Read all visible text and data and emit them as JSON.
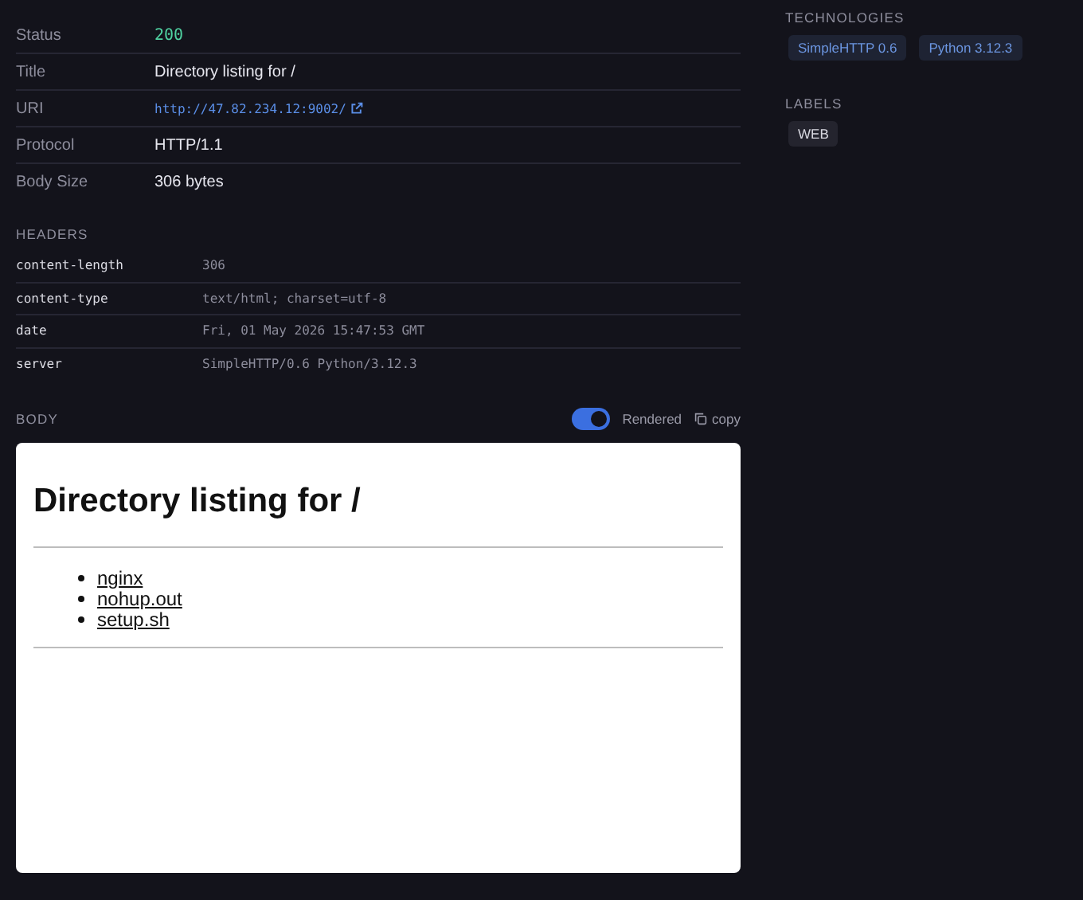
{
  "http": {
    "rows": [
      {
        "label": "Status",
        "value": "200",
        "kind": "status"
      },
      {
        "label": "Title",
        "value": "Directory listing for /",
        "kind": "text"
      },
      {
        "label": "URI",
        "value": "http://47.82.234.12:9002/",
        "kind": "link"
      },
      {
        "label": "Protocol",
        "value": "HTTP/1.1",
        "kind": "text"
      },
      {
        "label": "Body Size",
        "value": "306 bytes",
        "kind": "text"
      }
    ]
  },
  "headers": {
    "title": "HEADERS",
    "rows": [
      {
        "name": "content-length",
        "value": "306"
      },
      {
        "name": "content-type",
        "value": "text/html; charset=utf-8"
      },
      {
        "name": "date",
        "value": "Fri, 01 May 2026 15:47:53 GMT"
      },
      {
        "name": "server",
        "value": "SimpleHTTP/0.6 Python/3.12.3"
      }
    ]
  },
  "body": {
    "title": "BODY",
    "rendered": {
      "label": "Rendered",
      "on": true
    },
    "copy": "copy",
    "page": {
      "heading": "Directory listing for /",
      "links": [
        "nginx",
        "nohup.out",
        "setup.sh"
      ]
    }
  },
  "technologies": {
    "title": "TECHNOLOGIES",
    "items": [
      "SimpleHTTP 0.6",
      "Python 3.12.3"
    ]
  },
  "labels": {
    "title": "LABELS",
    "items": [
      "WEB"
    ]
  }
}
